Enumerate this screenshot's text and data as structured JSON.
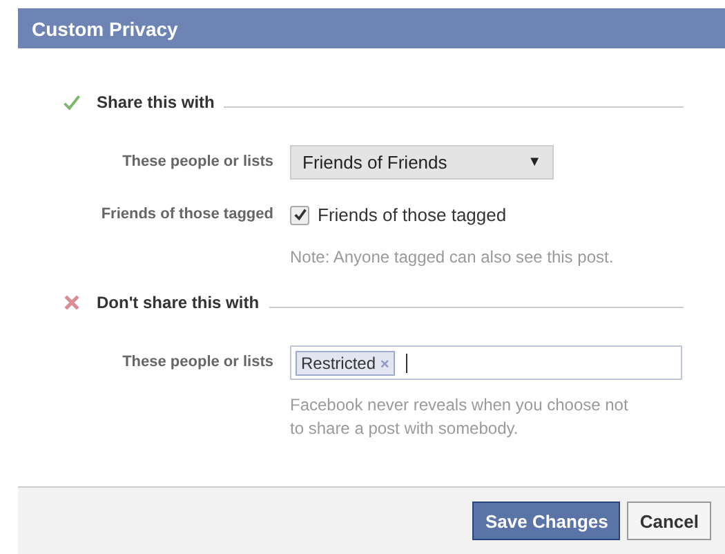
{
  "dialog": {
    "title": "Custom Privacy"
  },
  "sections": [
    {
      "kind": "share",
      "title": "Share this with",
      "rows": [
        {
          "kind": "dropdown",
          "label": "These people or lists",
          "value": "Friends of Friends",
          "caret": "▼"
        },
        {
          "kind": "checkbox",
          "label": "Friends of those tagged",
          "option": "Friends of those tagged",
          "checked": true,
          "note": "Note: Anyone tagged can also see this post."
        }
      ]
    },
    {
      "kind": "dont",
      "title": "Don't share this with",
      "rows": [
        {
          "kind": "tokens",
          "label": "These people or lists",
          "tokens": [
            {
              "text": "Restricted",
              "remove": "×"
            }
          ],
          "note": "Facebook never reveals when you choose not to share a post with somebody."
        }
      ]
    }
  ],
  "buttons": [
    {
      "label": "Save Changes",
      "primary": true
    },
    {
      "label": "Cancel",
      "primary": false
    }
  ]
}
